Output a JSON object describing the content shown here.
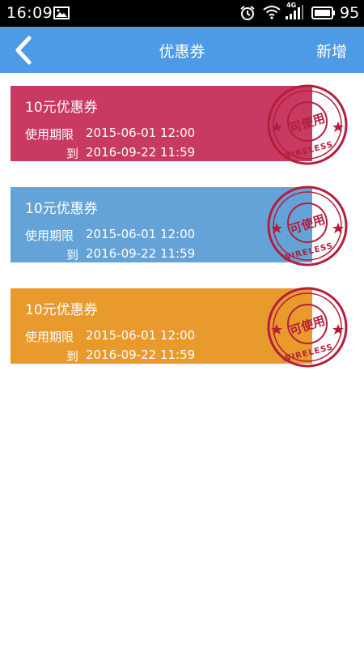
{
  "status_bar": {
    "time": "16:09",
    "network": "4G",
    "battery": "95",
    "icons": [
      "gallery-icon",
      "alarm-icon",
      "wifi-icon",
      "signal-icon",
      "battery-icon"
    ]
  },
  "nav": {
    "back_icon": "chevron-left-icon",
    "title": "优惠券",
    "add_label": "新增"
  },
  "colors": {
    "status_bar": "#000000",
    "nav_bar": "#4d9ae6",
    "stamp": "#b41e3c"
  },
  "coupons": [
    {
      "amount": "10元优惠券",
      "valid_label": "使用期限",
      "start": "2015-06-01 12:00",
      "to_label": "到",
      "end": "2016-09-22 11:59",
      "color": "#c93a62",
      "stamp_text": "可使用",
      "stamp_sub": "WIRELESS"
    },
    {
      "amount": "10元优惠券",
      "valid_label": "使用期限",
      "start": "2015-06-01 12:00",
      "to_label": "到",
      "end": "2016-09-22 11:59",
      "color": "#64a3d7",
      "stamp_text": "可使用",
      "stamp_sub": "WIRELESS"
    },
    {
      "amount": "10元优惠券",
      "valid_label": "使用期限",
      "start": "2015-06-01 12:00",
      "to_label": "到",
      "end": "2016-09-22 11:59",
      "color": "#e89a2c",
      "stamp_text": "可使用",
      "stamp_sub": "WIRELESS"
    }
  ]
}
